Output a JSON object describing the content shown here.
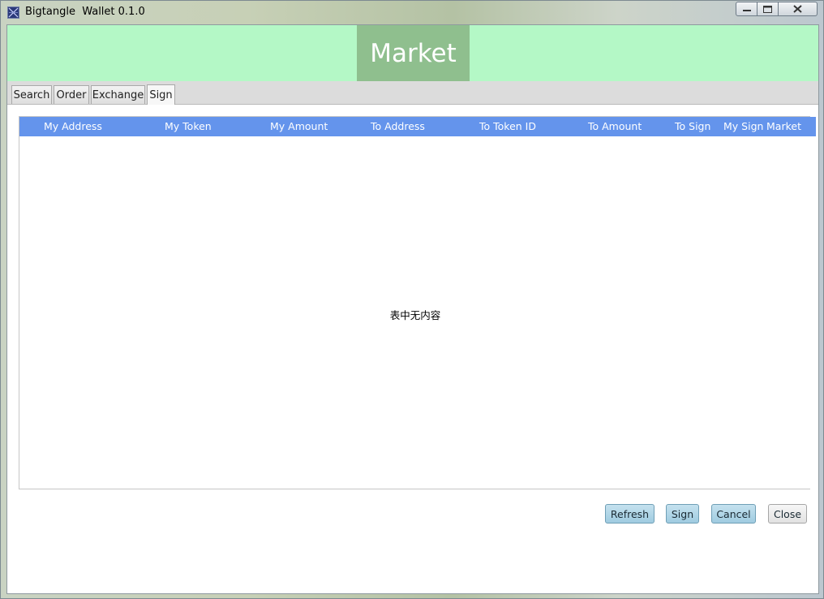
{
  "window": {
    "title": "Bigtangle  Wallet 0.1.0"
  },
  "banner": {
    "title": "Market"
  },
  "tabs": [
    {
      "label": "Search"
    },
    {
      "label": "Order"
    },
    {
      "label": "Exchange"
    },
    {
      "label": "Sign",
      "active": true
    }
  ],
  "table": {
    "columns": [
      "My Address",
      "My Token",
      "My Amount",
      "To Address",
      "To Token ID",
      "To Amount",
      "To Sign",
      "My Sign",
      "Market"
    ],
    "rows": [],
    "empty_message": "表中无内容"
  },
  "actions": {
    "refresh_label": "Refresh",
    "sign_label": "Sign",
    "cancel_label": "Cancel",
    "close_label": "Close"
  },
  "colors": {
    "banner_bg": "#b4f8c6",
    "banner_title_bg": "#8fbf8e",
    "table_header_bg": "#6494ec",
    "action_button_bg": "#a9d3e6"
  }
}
